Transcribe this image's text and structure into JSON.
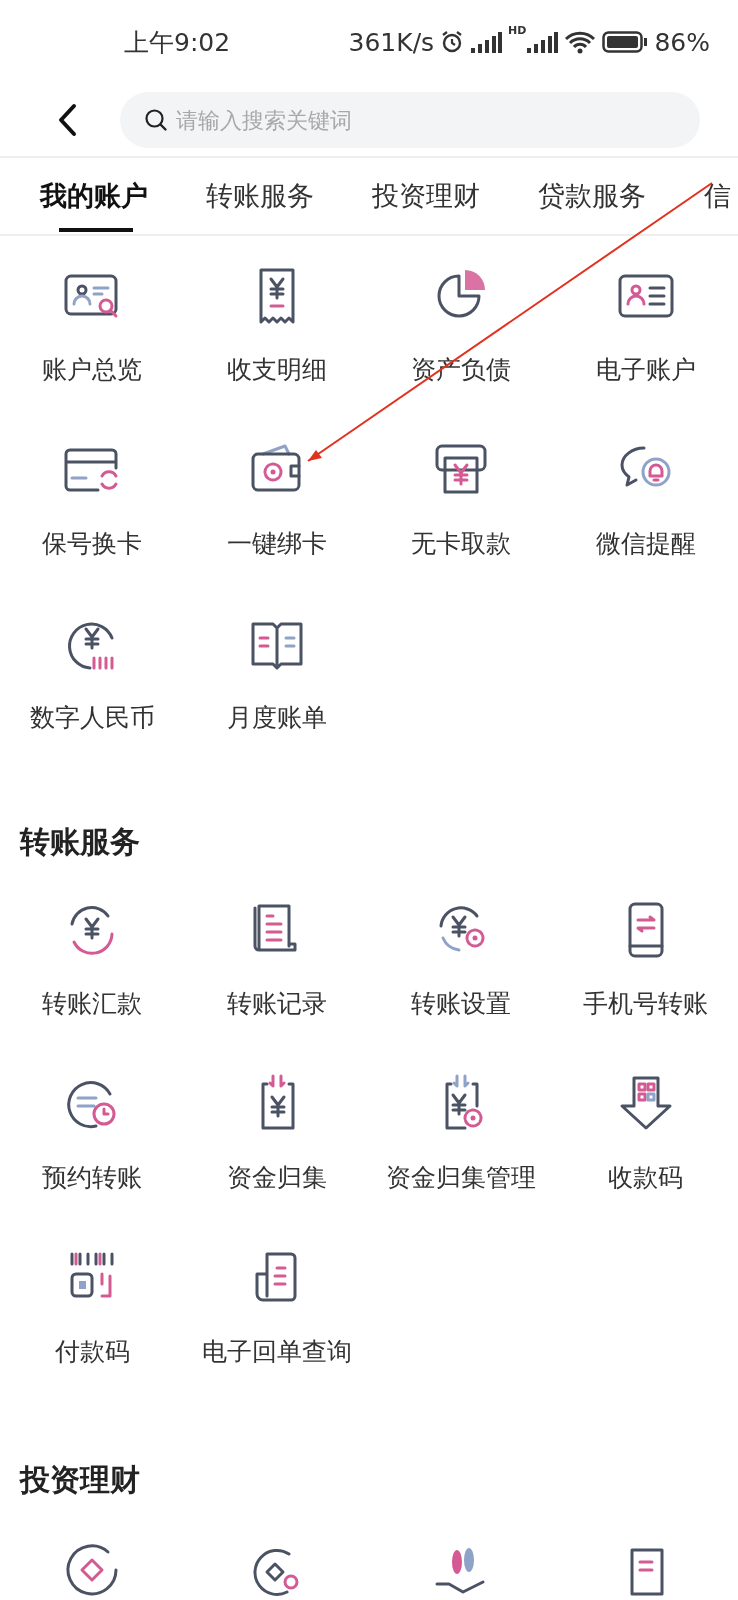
{
  "status_bar": {
    "time": "上午9:02",
    "speed": "361K/s",
    "network_label": "HD",
    "battery": "86%"
  },
  "header": {
    "search": {
      "placeholder": "请输入搜索关键词"
    }
  },
  "tabs": [
    {
      "label": "我的账户",
      "selected": true
    },
    {
      "label": "转账服务",
      "selected": false
    },
    {
      "label": "投资理财",
      "selected": false
    },
    {
      "label": "贷款服务",
      "selected": false
    },
    {
      "label": "信",
      "selected": false
    }
  ],
  "sections": [
    {
      "items": [
        {
          "kind": "tile",
          "label": "账户总览"
        },
        {
          "kind": "tile",
          "label": "收支明细"
        },
        {
          "kind": "tile",
          "label": "资产负债"
        },
        {
          "kind": "tile",
          "label": "电子账户"
        },
        {
          "kind": "tile",
          "label": "保号换卡"
        },
        {
          "kind": "tile",
          "label": "一键绑卡"
        },
        {
          "kind": "tile",
          "label": "无卡取款"
        },
        {
          "kind": "tile",
          "label": "微信提醒"
        },
        {
          "kind": "tile",
          "label": "数字人民币"
        },
        {
          "kind": "tile",
          "label": "月度账单"
        }
      ]
    },
    {
      "title": "转账服务",
      "items": [
        {
          "kind": "tile",
          "label": "转账汇款"
        },
        {
          "kind": "tile",
          "label": "转账记录"
        },
        {
          "kind": "tile",
          "label": "转账设置"
        },
        {
          "kind": "tile",
          "label": "手机号转账"
        },
        {
          "kind": "tile",
          "label": "预约转账"
        },
        {
          "kind": "tile",
          "label": "资金归集"
        },
        {
          "kind": "tile",
          "label": "资金归集管理"
        },
        {
          "kind": "tile",
          "label": "收款码"
        },
        {
          "kind": "tile",
          "label": "付款码"
        },
        {
          "kind": "tile",
          "label": "电子回单查询"
        }
      ]
    },
    {
      "title": "投资理财",
      "items": [
        {
          "kind": "cut"
        },
        {
          "kind": "cut"
        },
        {
          "kind": "cut"
        },
        {
          "kind": "cut"
        }
      ]
    }
  ]
}
